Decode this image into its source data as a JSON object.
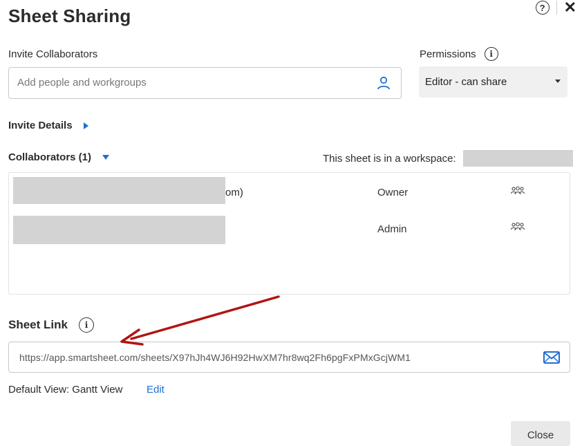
{
  "dialog": {
    "title": "Sheet Sharing"
  },
  "header_icons": {
    "help": "?",
    "close": "✕"
  },
  "invite": {
    "label": "Invite Collaborators",
    "placeholder": "Add people and workgroups"
  },
  "permissions": {
    "label": "Permissions",
    "selected": "Editor - can share"
  },
  "invite_details": {
    "label": "Invite Details"
  },
  "collaborators": {
    "label": "Collaborators (1)",
    "workspace_note": "This sheet is in a workspace:",
    "rows": [
      {
        "name_tail": "om)",
        "role": "Owner",
        "icon": "group-icon"
      },
      {
        "name_tail": "",
        "role": "Admin",
        "icon": "group-icon"
      }
    ]
  },
  "sheet_link": {
    "label": "Sheet Link",
    "url": "https://app.smartsheet.com/sheets/X97hJh4WJ6H92HwXM7hr8wq2Fh6pgFxPMxGcjWM1"
  },
  "default_view": {
    "label": "Default View: Gantt View",
    "edit_label": "Edit"
  },
  "footer": {
    "close_label": "Close"
  },
  "colors": {
    "accent": "#1f6fd1",
    "arrow": "#b01515",
    "redaction": "#d3d3d3"
  }
}
